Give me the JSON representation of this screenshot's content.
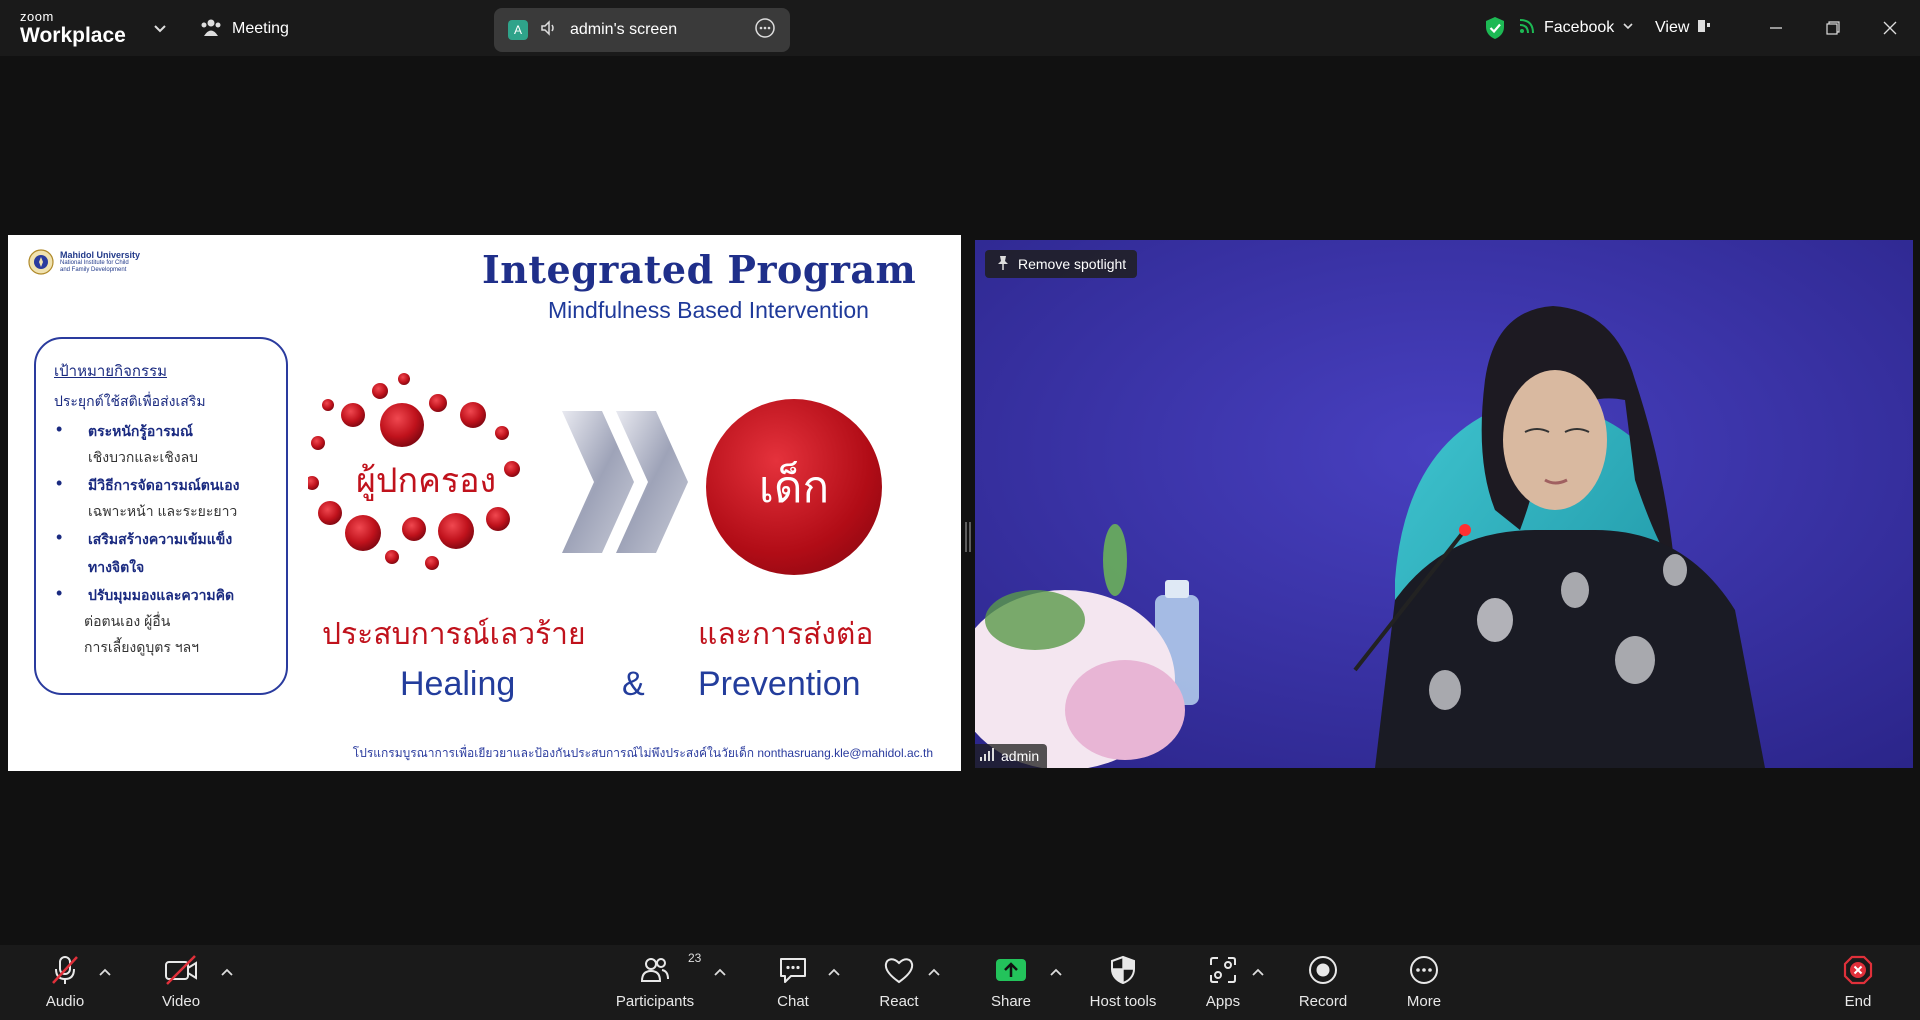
{
  "titlebar": {
    "brand_small": "zoom",
    "brand_big": "Workplace",
    "meeting_label": "Meeting",
    "screen_badge": "A",
    "screen_label": "admin's screen",
    "live_platform": "Facebook",
    "view_label": "View"
  },
  "slide": {
    "university": "Mahidol University",
    "institute_line1": "National Institute for Child",
    "institute_line2": "and Family Development",
    "title": "Integrated Program",
    "subtitle": "Mindfulness Based Intervention",
    "goal_title": "เป้าหมายกิจกรรม",
    "goal_intro": "ประยุกต์ใช้สติเพื่อส่งเสริม",
    "goals": [
      {
        "head": "ตระหนักรู้อารมณ์",
        "detail": "เชิงบวกและเชิงลบ"
      },
      {
        "head": "มีวิธีการจัดอารมณ์ตนเอง",
        "detail": "เฉพาะหน้า และระยะยาว"
      },
      {
        "head": "เสริมสร้างความเข้มแข็ง",
        "detail": "ทางจิตใจ"
      },
      {
        "head": "ปรับมุมมองและความคิด",
        "detail": "ต่อตนเอง ผู้อื่น"
      }
    ],
    "goal_extra": "การเลี้ยงดูบุตร ฯลฯ",
    "parent_label": "ผู้ปกครอง",
    "child_label": "เด็ก",
    "trauma_label": "ประสบการณ์เลวร้าย",
    "referral_label": "และการส่งต่อ",
    "healing": "Healing",
    "ampersand": "&",
    "prevention": "Prevention",
    "footer": "โปรแกรมบูรณาการเพื่อเยียวยาและป้องกันประสบการณ์ไม่พึงประสงค์ในวัยเด็ก nonthasruang.kle@mahidol.ac.th"
  },
  "video": {
    "spotlight_label": "Remove spotlight",
    "participant_name": "admin"
  },
  "toolbar": {
    "audio": "Audio",
    "video": "Video",
    "participants": "Participants",
    "participants_count": "23",
    "chat": "Chat",
    "react": "React",
    "share": "Share",
    "host_tools": "Host tools",
    "apps": "Apps",
    "record": "Record",
    "more": "More",
    "end": "End"
  },
  "colors": {
    "accent_green": "#1db954",
    "share_green": "#23c35b",
    "muted_red": "#e0303a",
    "slide_blue": "#1f2f8a",
    "slide_red": "#c0121c"
  }
}
